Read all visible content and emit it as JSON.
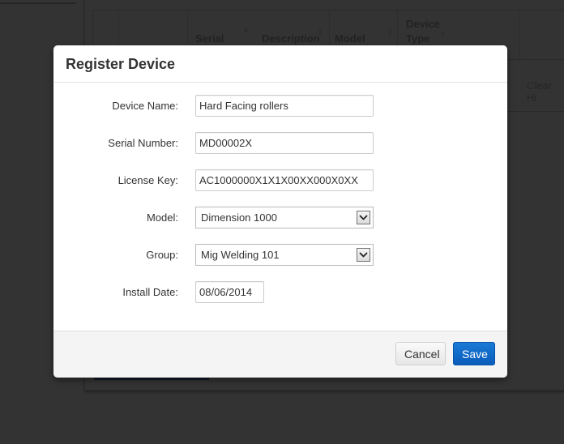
{
  "background": {
    "table_headers": [
      {
        "label": "Serial",
        "sorted": "ascending"
      },
      {
        "label": "Description"
      },
      {
        "label": "Model"
      },
      {
        "label": "Device Type"
      }
    ],
    "row_link": "Clear Hi"
  },
  "modal": {
    "title": "Register Device",
    "fields": {
      "device_name": {
        "label": "Device Name:",
        "value": "Hard Facing rollers"
      },
      "serial_number": {
        "label": "Serial Number:",
        "value": "MD00002X"
      },
      "license_key": {
        "label": "License Key:",
        "value": "AC1000000X1X1X00XX000X0XX"
      },
      "model": {
        "label": "Model:",
        "selected": "Dimension 1000"
      },
      "group": {
        "label": "Group:",
        "selected": "Mig Welding 101"
      },
      "install_date": {
        "label": "Install Date:",
        "value": "08/06/2014"
      }
    },
    "footer": {
      "cancel_label": "Cancel",
      "save_label": "Save"
    }
  },
  "icons": {
    "sort": "sort-icon",
    "dropdown": "chevron-down-icon"
  },
  "colors": {
    "primary": "#0a64c6",
    "overlay": "#333333"
  }
}
